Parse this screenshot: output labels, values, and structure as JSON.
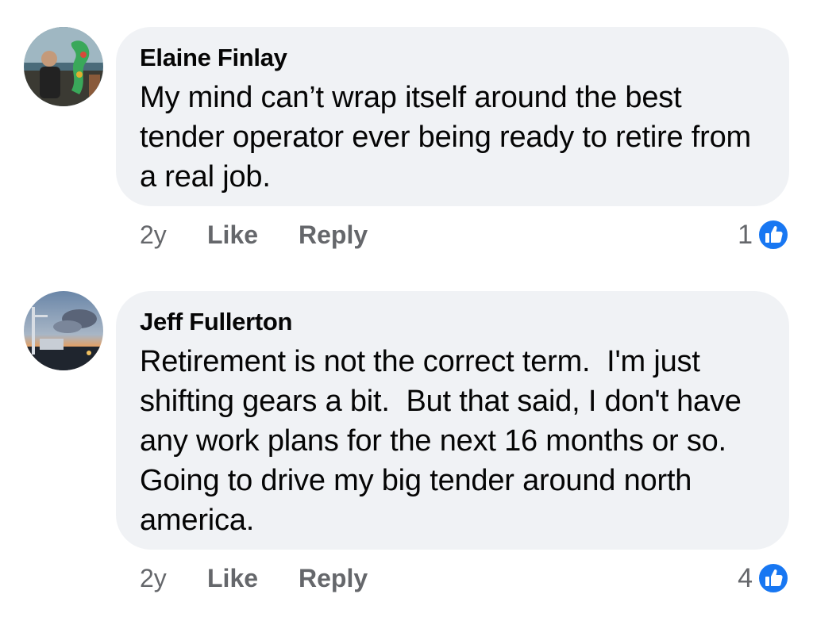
{
  "comments": [
    {
      "author": "Elaine Finlay",
      "text": "My mind can’t wrap itself around the best tender operator ever being ready to retire from a real job.",
      "age": "2y",
      "like_label": "Like",
      "reply_label": "Reply",
      "reaction_count": "1",
      "reaction_icon": "thumbs-up-icon",
      "reaction_color": "#1877f2"
    },
    {
      "author": "Jeff Fullerton",
      "text": "Retirement is not the correct term.  I'm just shifting gears a bit.  But that said, I don't have any work plans for the next 16 months or so.  Going to drive my big tender around north america.",
      "age": "2y",
      "like_label": "Like",
      "reply_label": "Reply",
      "reaction_count": "4",
      "reaction_icon": "thumbs-up-icon",
      "reaction_color": "#1877f2"
    }
  ]
}
